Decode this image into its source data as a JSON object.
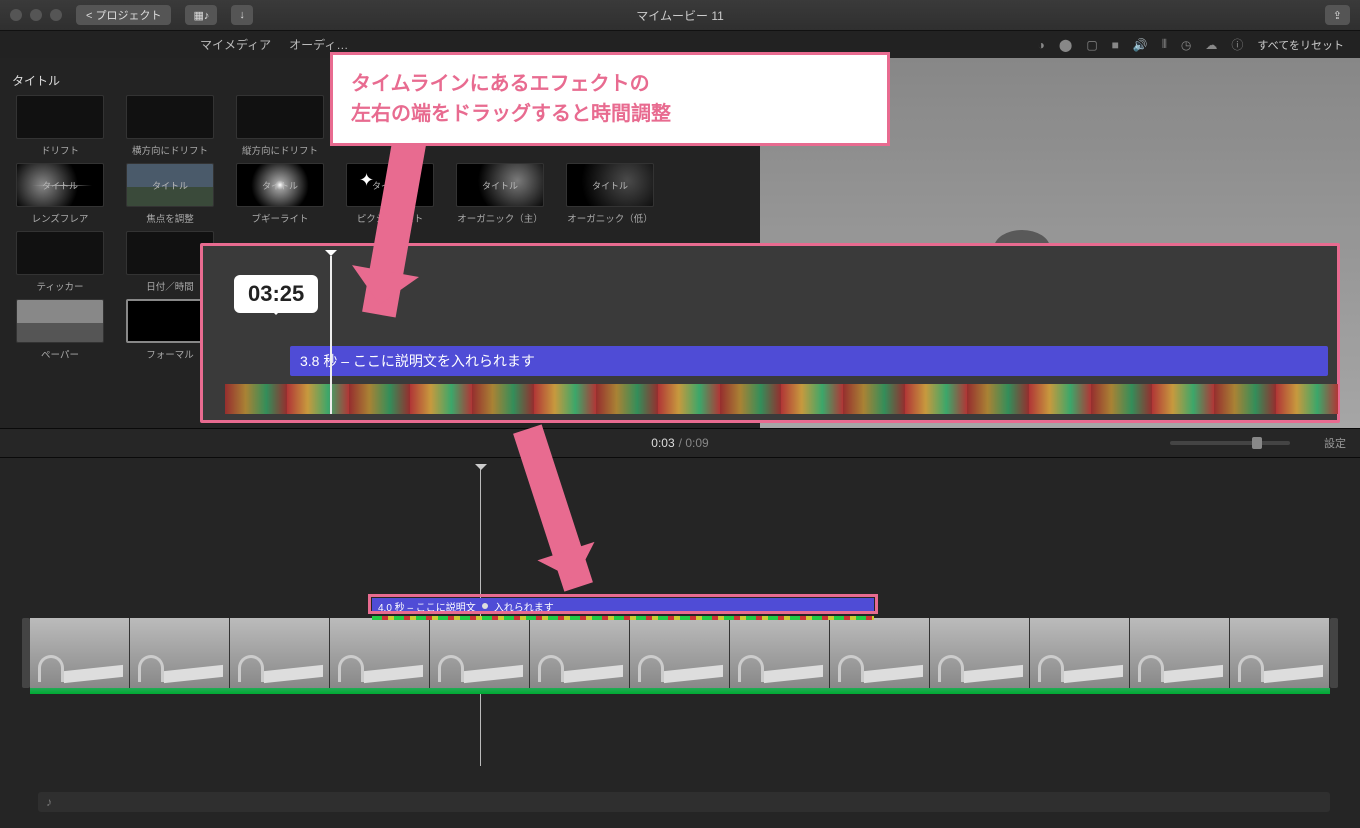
{
  "titlebar": {
    "back": "< プロジェクト",
    "window_title": "マイムービー 11"
  },
  "tabs": {
    "mymedia": "マイメディア",
    "audio": "オーディ…",
    "reset": "すべてをリセット"
  },
  "sidebar_label": "タイトル",
  "thumbs": {
    "r1": [
      "ドリフト",
      "横方向にドリフト",
      "縦方向にドリフト"
    ],
    "r2": [
      "レンズフレア",
      "焦点を調整",
      "ブギーライト",
      "ピクシーダスト",
      "オーガニック（主）",
      "オーガニック（低）"
    ],
    "r2text": [
      "タイトル",
      "タイトル",
      "タイトル",
      "タイトル",
      "タイトル",
      "タイトル"
    ],
    "r3": [
      "ティッカー",
      "日付／時間"
    ],
    "r4": [
      "ペーパー",
      "フォーマル"
    ]
  },
  "bubble_time": "03:25",
  "title_clip_text": "3.8 秒 – ここに説明文を入れられます",
  "tc": {
    "current": "0:03",
    "total": "0:09",
    "settings": "設定"
  },
  "clip2_text_a": "4.0 秒 – ここに説明文",
  "clip2_text_b": "入れられます",
  "callout_l1": "タイムラインにあるエフェクトの",
  "callout_l2": "左右の端をドラッグすると時間調整"
}
